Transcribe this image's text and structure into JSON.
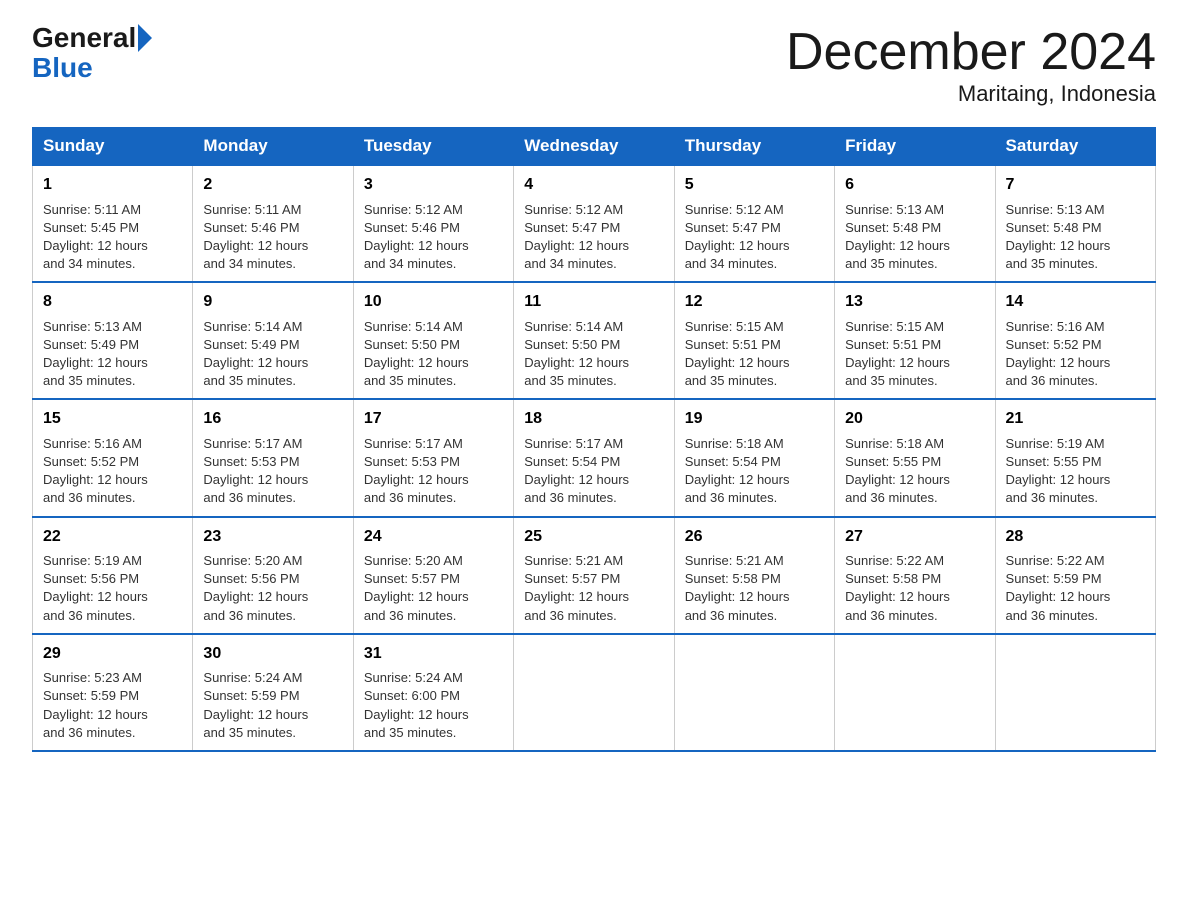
{
  "logo": {
    "general": "General",
    "blue": "Blue"
  },
  "title": "December 2024",
  "location": "Maritaing, Indonesia",
  "days_of_week": [
    "Sunday",
    "Monday",
    "Tuesday",
    "Wednesday",
    "Thursday",
    "Friday",
    "Saturday"
  ],
  "weeks": [
    [
      {
        "day": "1",
        "sunrise": "5:11 AM",
        "sunset": "5:45 PM",
        "daylight": "12 hours and 34 minutes."
      },
      {
        "day": "2",
        "sunrise": "5:11 AM",
        "sunset": "5:46 PM",
        "daylight": "12 hours and 34 minutes."
      },
      {
        "day": "3",
        "sunrise": "5:12 AM",
        "sunset": "5:46 PM",
        "daylight": "12 hours and 34 minutes."
      },
      {
        "day": "4",
        "sunrise": "5:12 AM",
        "sunset": "5:47 PM",
        "daylight": "12 hours and 34 minutes."
      },
      {
        "day": "5",
        "sunrise": "5:12 AM",
        "sunset": "5:47 PM",
        "daylight": "12 hours and 34 minutes."
      },
      {
        "day": "6",
        "sunrise": "5:13 AM",
        "sunset": "5:48 PM",
        "daylight": "12 hours and 35 minutes."
      },
      {
        "day": "7",
        "sunrise": "5:13 AM",
        "sunset": "5:48 PM",
        "daylight": "12 hours and 35 minutes."
      }
    ],
    [
      {
        "day": "8",
        "sunrise": "5:13 AM",
        "sunset": "5:49 PM",
        "daylight": "12 hours and 35 minutes."
      },
      {
        "day": "9",
        "sunrise": "5:14 AM",
        "sunset": "5:49 PM",
        "daylight": "12 hours and 35 minutes."
      },
      {
        "day": "10",
        "sunrise": "5:14 AM",
        "sunset": "5:50 PM",
        "daylight": "12 hours and 35 minutes."
      },
      {
        "day": "11",
        "sunrise": "5:14 AM",
        "sunset": "5:50 PM",
        "daylight": "12 hours and 35 minutes."
      },
      {
        "day": "12",
        "sunrise": "5:15 AM",
        "sunset": "5:51 PM",
        "daylight": "12 hours and 35 minutes."
      },
      {
        "day": "13",
        "sunrise": "5:15 AM",
        "sunset": "5:51 PM",
        "daylight": "12 hours and 35 minutes."
      },
      {
        "day": "14",
        "sunrise": "5:16 AM",
        "sunset": "5:52 PM",
        "daylight": "12 hours and 36 minutes."
      }
    ],
    [
      {
        "day": "15",
        "sunrise": "5:16 AM",
        "sunset": "5:52 PM",
        "daylight": "12 hours and 36 minutes."
      },
      {
        "day": "16",
        "sunrise": "5:17 AM",
        "sunset": "5:53 PM",
        "daylight": "12 hours and 36 minutes."
      },
      {
        "day": "17",
        "sunrise": "5:17 AM",
        "sunset": "5:53 PM",
        "daylight": "12 hours and 36 minutes."
      },
      {
        "day": "18",
        "sunrise": "5:17 AM",
        "sunset": "5:54 PM",
        "daylight": "12 hours and 36 minutes."
      },
      {
        "day": "19",
        "sunrise": "5:18 AM",
        "sunset": "5:54 PM",
        "daylight": "12 hours and 36 minutes."
      },
      {
        "day": "20",
        "sunrise": "5:18 AM",
        "sunset": "5:55 PM",
        "daylight": "12 hours and 36 minutes."
      },
      {
        "day": "21",
        "sunrise": "5:19 AM",
        "sunset": "5:55 PM",
        "daylight": "12 hours and 36 minutes."
      }
    ],
    [
      {
        "day": "22",
        "sunrise": "5:19 AM",
        "sunset": "5:56 PM",
        "daylight": "12 hours and 36 minutes."
      },
      {
        "day": "23",
        "sunrise": "5:20 AM",
        "sunset": "5:56 PM",
        "daylight": "12 hours and 36 minutes."
      },
      {
        "day": "24",
        "sunrise": "5:20 AM",
        "sunset": "5:57 PM",
        "daylight": "12 hours and 36 minutes."
      },
      {
        "day": "25",
        "sunrise": "5:21 AM",
        "sunset": "5:57 PM",
        "daylight": "12 hours and 36 minutes."
      },
      {
        "day": "26",
        "sunrise": "5:21 AM",
        "sunset": "5:58 PM",
        "daylight": "12 hours and 36 minutes."
      },
      {
        "day": "27",
        "sunrise": "5:22 AM",
        "sunset": "5:58 PM",
        "daylight": "12 hours and 36 minutes."
      },
      {
        "day": "28",
        "sunrise": "5:22 AM",
        "sunset": "5:59 PM",
        "daylight": "12 hours and 36 minutes."
      }
    ],
    [
      {
        "day": "29",
        "sunrise": "5:23 AM",
        "sunset": "5:59 PM",
        "daylight": "12 hours and 36 minutes."
      },
      {
        "day": "30",
        "sunrise": "5:24 AM",
        "sunset": "5:59 PM",
        "daylight": "12 hours and 35 minutes."
      },
      {
        "day": "31",
        "sunrise": "5:24 AM",
        "sunset": "6:00 PM",
        "daylight": "12 hours and 35 minutes."
      },
      null,
      null,
      null,
      null
    ]
  ],
  "labels": {
    "sunrise": "Sunrise:",
    "sunset": "Sunset:",
    "daylight": "Daylight:"
  }
}
